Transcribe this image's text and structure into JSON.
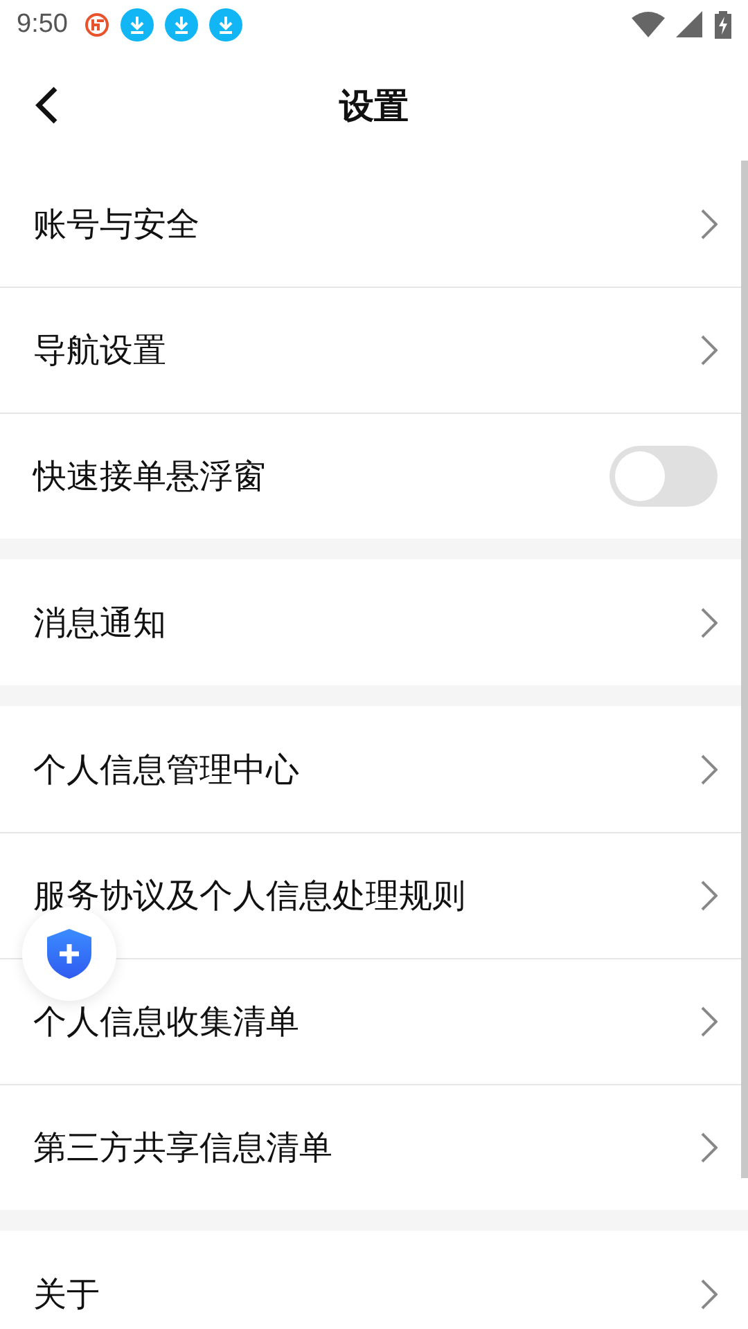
{
  "status_bar": {
    "time": "9:50"
  },
  "header": {
    "title": "设置"
  },
  "groups": [
    {
      "items": [
        {
          "kind": "link",
          "label": "账号与安全"
        },
        {
          "kind": "link",
          "label": "导航设置"
        },
        {
          "kind": "toggle",
          "label": "快速接单悬浮窗",
          "on": false
        }
      ]
    },
    {
      "items": [
        {
          "kind": "link",
          "label": "消息通知"
        }
      ]
    },
    {
      "items": [
        {
          "kind": "link",
          "label": "个人信息管理中心"
        },
        {
          "kind": "link",
          "label": "服务协议及个人信息处理规则"
        },
        {
          "kind": "link",
          "label": "个人信息收集清单"
        },
        {
          "kind": "link",
          "label": "第三方共享信息清单"
        }
      ]
    },
    {
      "items": [
        {
          "kind": "link",
          "label": "关于"
        }
      ]
    }
  ]
}
